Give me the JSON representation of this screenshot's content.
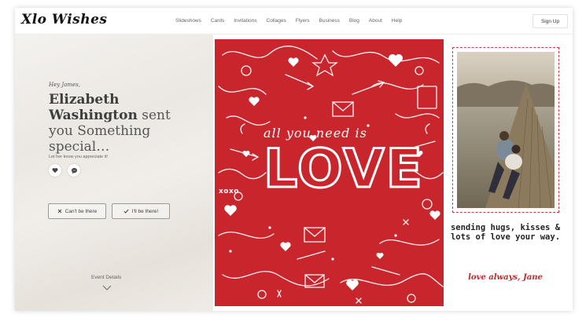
{
  "header": {
    "logo": "Xlo Wishes",
    "nav": [
      "Slideshows",
      "Cards",
      "Invitations",
      "Collages",
      "Flyers",
      "Business",
      "Blog",
      "About",
      "Help"
    ],
    "signup": "Sign Up"
  },
  "invite": {
    "greeting": "Hey James,",
    "sender": "Elizabeth Washington",
    "message": " sent you Something special…",
    "appreciate": "Let her know you appreciate it!",
    "cant_label": "Can't be there",
    "be_label": "I'll be there!",
    "event_details": "Event Details"
  },
  "card": {
    "tagline": "all you need is",
    "love": "LOVE",
    "xoxo": "xoxo",
    "note": "sending hugs, kisses & lots of love your way.",
    "signature": "love always, Jane"
  },
  "colors": {
    "red": "#c8262c",
    "white": "#ffffff"
  },
  "icons": [
    "heart-icon",
    "chat-icon",
    "close-icon",
    "check-icon",
    "chevron-down-icon"
  ]
}
